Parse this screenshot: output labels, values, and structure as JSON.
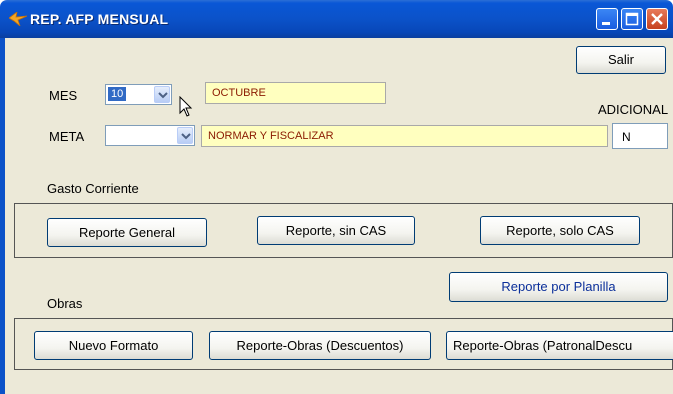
{
  "window": {
    "title": "REP. AFP MENSUAL"
  },
  "header": {
    "salir_label": "Salir",
    "adicional_label": "ADICIONAL",
    "adicional_value": "N"
  },
  "filters": {
    "mes_label": "MES",
    "mes_value": "10",
    "mes_name": "OCTUBRE",
    "meta_label": "META",
    "meta_value": "",
    "meta_name": "NORMAR Y FISCALIZAR"
  },
  "gasto_corriente": {
    "label": "Gasto Corriente",
    "buttons": [
      "Reporte General",
      "Reporte, sin CAS",
      "Reporte, solo CAS"
    ]
  },
  "reporte_planilla_label": "Reporte por Planilla",
  "obras": {
    "label": "Obras",
    "buttons": [
      "Nuevo Formato",
      "Reporte-Obras (Descuentos)",
      "Reporte-Obras (PatronalDescu"
    ]
  },
  "icons": {
    "app": "app-icon",
    "cursor": "mouse-pointer-icon"
  },
  "colors": {
    "title_bar": "#0b52c9",
    "client_bg": "#ece9d8",
    "highlight_field": "#ffffbf",
    "field_text": "#8b1a00"
  }
}
